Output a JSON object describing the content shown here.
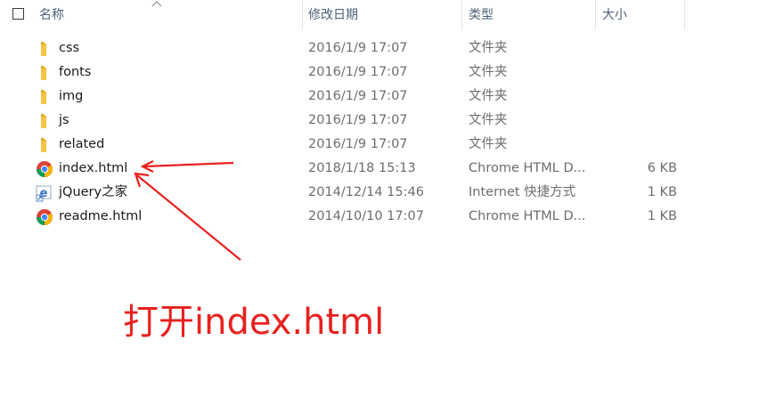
{
  "header": {
    "name": "名称",
    "date": "修改日期",
    "type": "类型",
    "size": "大小"
  },
  "files": [
    {
      "name": "css",
      "date": "2016/1/9 17:07",
      "type": "文件夹",
      "size": "",
      "icon": "folder-icon"
    },
    {
      "name": "fonts",
      "date": "2016/1/9 17:07",
      "type": "文件夹",
      "size": "",
      "icon": "folder-icon"
    },
    {
      "name": "img",
      "date": "2016/1/9 17:07",
      "type": "文件夹",
      "size": "",
      "icon": "folder-icon"
    },
    {
      "name": "js",
      "date": "2016/1/9 17:07",
      "type": "文件夹",
      "size": "",
      "icon": "folder-icon"
    },
    {
      "name": "related",
      "date": "2016/1/9 17:07",
      "type": "文件夹",
      "size": "",
      "icon": "folder-icon"
    },
    {
      "name": "index.html",
      "date": "2018/1/18 15:13",
      "type": "Chrome HTML D...",
      "size": "6 KB",
      "icon": "chrome-icon"
    },
    {
      "name": "jQuery之家",
      "date": "2014/12/14 15:46",
      "type": "Internet 快捷方式",
      "size": "1 KB",
      "icon": "internet-shortcut-icon"
    },
    {
      "name": "readme.html",
      "date": "2014/10/10 17:07",
      "type": "Chrome HTML D...",
      "size": "1 KB",
      "icon": "chrome-icon"
    }
  ],
  "annotation": {
    "text": "打开index.html",
    "color": "#e8211f"
  },
  "colors": {
    "folder": "#f4c542",
    "header_text": "#4c607a",
    "secondary_text": "#6d6d6d"
  }
}
